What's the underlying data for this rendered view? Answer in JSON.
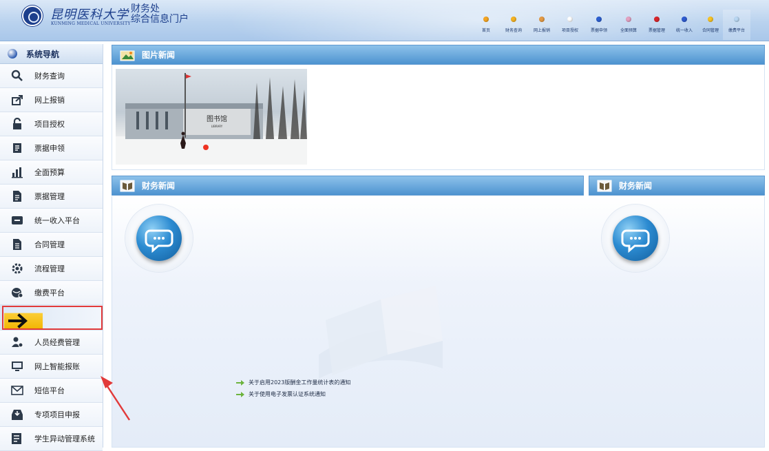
{
  "header": {
    "logo_cn": "昆明医科大学",
    "logo_en": "KUNMING MEDICAL UNIVERSITY",
    "portal_line1": "财务处",
    "portal_line2": "综合信息门户"
  },
  "top_nav": [
    {
      "label": "首页",
      "color": "#f5a623"
    },
    {
      "label": "财务查询",
      "color": "#f5b323"
    },
    {
      "label": "网上报销",
      "color": "#e59b45"
    },
    {
      "label": "项目授权",
      "color": "#ffffff"
    },
    {
      "label": "票据申领",
      "color": "#2d5fd0"
    },
    {
      "label": "全面预算",
      "color": "#e3a2c2"
    },
    {
      "label": "票据管理",
      "color": "#d8262c"
    },
    {
      "label": "统一收入",
      "color": "#2f5bd0"
    },
    {
      "label": "合同管理",
      "color": "#f7c325"
    },
    {
      "label": "缴费平台",
      "color": "#b9d7f2"
    }
  ],
  "sidebar": {
    "title": "系统导航",
    "items": [
      {
        "label": "财务查询",
        "icon": "search-icon"
      },
      {
        "label": "网上报销",
        "icon": "share-icon"
      },
      {
        "label": "项目授权",
        "icon": "lock-icon"
      },
      {
        "label": "票据申领",
        "icon": "invoice-icon"
      },
      {
        "label": "全面预算",
        "icon": "bar-chart-icon"
      },
      {
        "label": "票据管理",
        "icon": "document-icon"
      },
      {
        "label": "统一收入平台",
        "icon": "card-icon"
      },
      {
        "label": "合同管理",
        "icon": "contract-icon"
      },
      {
        "label": "流程管理",
        "icon": "gear-icon"
      },
      {
        "label": "缴费平台",
        "icon": "globe-icon"
      }
    ],
    "items_after": [
      {
        "label": "人员经费管理",
        "icon": "user-gear-icon"
      },
      {
        "label": "网上智能报账",
        "icon": "monitor-icon"
      },
      {
        "label": "短信平台",
        "icon": "mail-icon"
      },
      {
        "label": "专项项目申报",
        "icon": "inbox-icon"
      },
      {
        "label": "学生异动管理系统",
        "icon": "list-icon"
      }
    ]
  },
  "main": {
    "pic_news_title": "图片新闻",
    "photo_sign": "图书馆",
    "photo_sign_en": "LIBRARY",
    "fin_news_title_left": "财务新闻",
    "fin_news_title_right": "财务新闻",
    "news_items": [
      "关于启用2023版酬金工作量统计表的通知",
      "关于使用电子发票认证系统通知"
    ]
  },
  "colors": {
    "accent_blue": "#4d93d0",
    "highlight_red": "#e23a3a",
    "arrow_yellow": "#f2b705"
  }
}
